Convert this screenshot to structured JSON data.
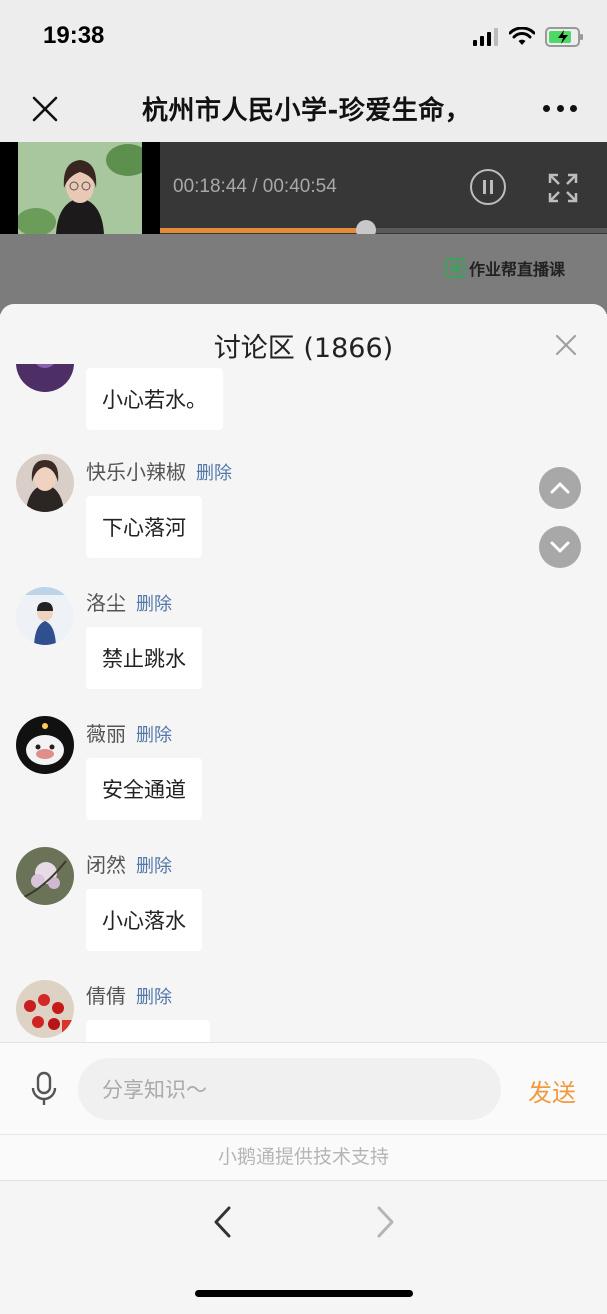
{
  "status_bar": {
    "time": "19:38"
  },
  "nav": {
    "title": "杭州市人民小学-珍爱生命，"
  },
  "player": {
    "time_display": "00:18:44 / 00:40:54",
    "progress": 0.46
  },
  "slide": {
    "logo_text": "作业帮直播课",
    "logo_badge": "课"
  },
  "discussion": {
    "title": "讨论区 (1866)",
    "delete_label": "删除",
    "messages": [
      {
        "name": "",
        "text": "小心若水。"
      },
      {
        "name": "快乐小辣椒",
        "text": "下心落河"
      },
      {
        "name": "洛尘",
        "text": "禁止跳水"
      },
      {
        "name": "薇丽",
        "text": "安全通道"
      },
      {
        "name": "闭然",
        "text": "小心落水"
      },
      {
        "name": "倩倩",
        "text": ""
      }
    ]
  },
  "input": {
    "placeholder": "分享知识～",
    "send_label": "发送"
  },
  "footer": {
    "support_text": "小鹅通提供技术支持"
  },
  "colors": {
    "accent": "#f19a3e",
    "delete_link": "#5277a8",
    "progress": "#e48b3a"
  }
}
